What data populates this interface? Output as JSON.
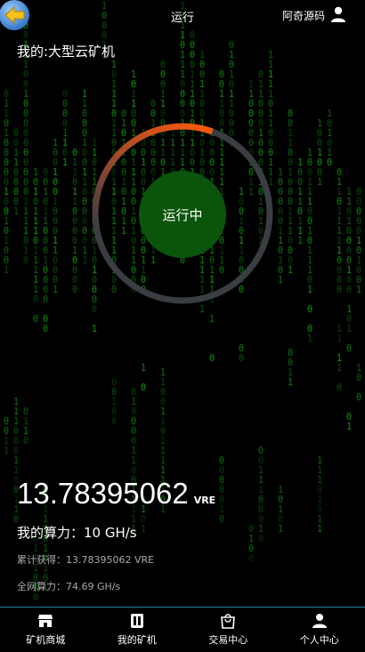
{
  "header": {
    "back_icon": "back-arrow-icon",
    "title": "运行",
    "brand": "阿奇源码",
    "user_icon": "user-icon"
  },
  "miner": {
    "name": "我的:大型云矿机"
  },
  "ring": {
    "status": "运行中",
    "progress": 0.15,
    "progress_color_start": "#a44a2a",
    "progress_color_end": "#ff5a0a",
    "track_color": "#3a3d42",
    "center_color": "#0b540b"
  },
  "balance": {
    "value": "13.78395062",
    "unit": "VRE"
  },
  "stats": {
    "hashrate": "我的算力：10 GH/s",
    "earned": "累计获得：13.78395062 VRE",
    "network": "全网算力：74.69 GH/s"
  },
  "tabs": [
    {
      "label": "矿机商城",
      "icon": "store-icon"
    },
    {
      "label": "我的矿机",
      "icon": "miner-icon"
    },
    {
      "label": "交易中心",
      "icon": "shopping-bag-icon"
    },
    {
      "label": "个人中心",
      "icon": "person-icon"
    }
  ],
  "colors": {
    "matrix": "#1db01d",
    "tabbar_border": "#2a7ea6"
  }
}
